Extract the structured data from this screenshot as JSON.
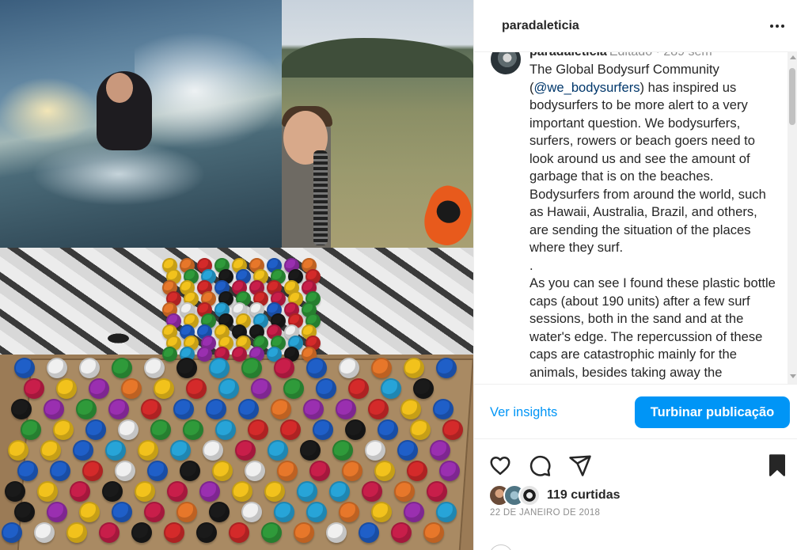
{
  "post": {
    "username": "paradaleticia",
    "more_icon": "more-horizontal-icon"
  },
  "caption": {
    "username": "paradaleticia",
    "meta": "Editado · 289 sem",
    "line1_pre": "The Global Bodysurf Community (",
    "mention": "@we_bodysurfers",
    "line1_post": ") has inspired us bodysurfers to be more alert to a very important question. We bodysurfers, surfers, rowers or beach goers need to look around us and see the amount of garbage that is on the beaches. Bodysurfers from around the world, such as Hawaii, Australia, Brazil, and others, are sending the situation of the places where they surf.",
    "dot": ".",
    "paragraph2": "As you can see I found these plastic bottle caps (about 190 units) after a few surf sessions, both in the sand and at the water's edge. The repercussion of these caps are catastrophic mainly for the animals, besides taking away the"
  },
  "insights": {
    "link_label": "Ver insights",
    "boost_label": "Turbinar publicação"
  },
  "actions": {
    "like_icon": "heart-icon",
    "comment_icon": "comment-icon",
    "share_icon": "share-icon",
    "save_icon": "bookmark-icon"
  },
  "likes": {
    "text": "119 curtidas"
  },
  "date": "22 DE JANEIRO DE 2018",
  "colors": {
    "accent": "#0095f6",
    "text": "#262626",
    "muted": "#8e8e8e",
    "mention": "#00376b"
  }
}
